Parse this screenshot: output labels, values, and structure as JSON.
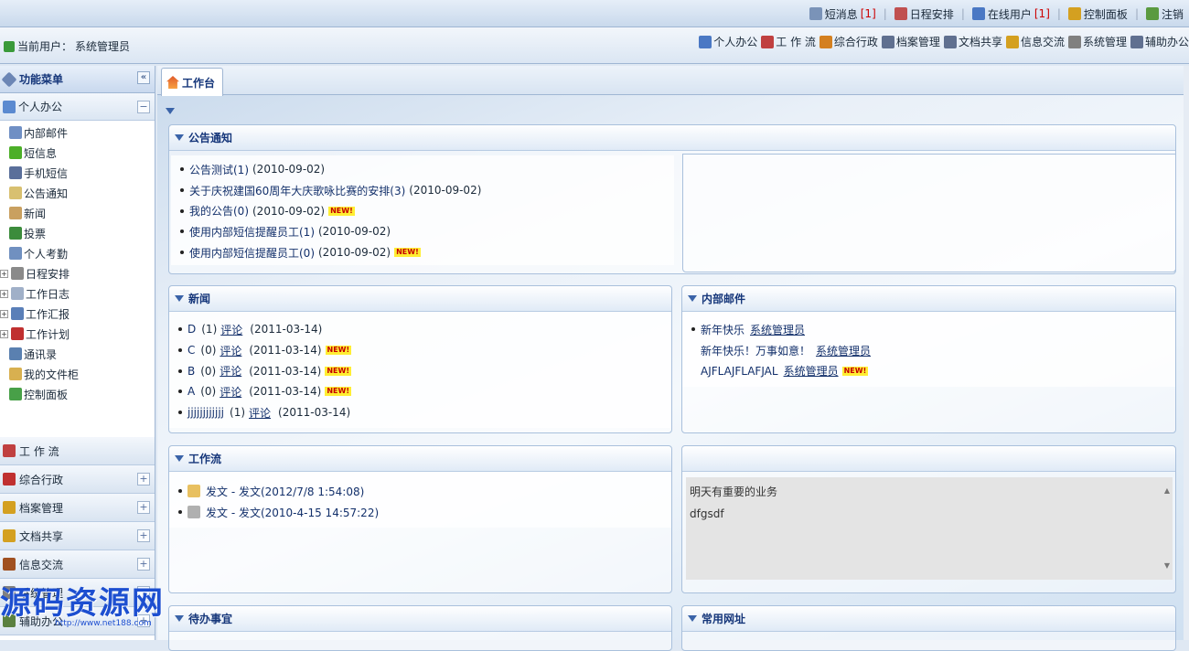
{
  "topbar": {
    "links": [
      {
        "label": "短消息",
        "count": "[1]",
        "icon": "envelope-icon",
        "color": "#7a93b8"
      },
      {
        "label": "日程安排",
        "count": "",
        "icon": "calendar-icon",
        "color": "#c05050"
      },
      {
        "label": "在线用户",
        "count": "[1]",
        "icon": "user-icon",
        "color": "#4a78c4"
      },
      {
        "label": "控制面板",
        "count": "",
        "icon": "key-icon",
        "color": "#d4a020"
      },
      {
        "label": "注销",
        "count": "",
        "icon": "logout-icon",
        "color": "#5a9a40"
      }
    ]
  },
  "userbar": {
    "current_user_label": "当前用户：",
    "current_user": "系统管理员",
    "modules": [
      {
        "label": "个人办公",
        "icon": "personal-office-icon",
        "color": "#4a78c4"
      },
      {
        "label": "工 作 流",
        "icon": "workflow-icon",
        "color": "#c04040"
      },
      {
        "label": "综合行政",
        "icon": "admin-icon",
        "color": "#d48020"
      },
      {
        "label": "档案管理",
        "icon": "archive-icon",
        "color": "#607090"
      },
      {
        "label": "文档共享",
        "icon": "document-share-icon",
        "color": "#607090"
      },
      {
        "label": "信息交流",
        "icon": "info-exchange-icon",
        "color": "#d4a020"
      },
      {
        "label": "系统管理",
        "icon": "system-gear-icon",
        "color": "#808080"
      },
      {
        "label": "辅助办公",
        "icon": "assist-office-icon",
        "color": "#607090"
      }
    ]
  },
  "sidebar": {
    "title": "功能菜单",
    "collapse_glyph": "«",
    "group_open": {
      "label": "个人办公",
      "toggle": "−"
    },
    "tree": [
      {
        "label": "内部邮件",
        "icon": "mail-icon",
        "color": "#6f8fc4",
        "expand": ""
      },
      {
        "label": "短信息",
        "icon": "speech-bubble-icon",
        "color": "#4caf28",
        "expand": ""
      },
      {
        "label": "手机短信",
        "icon": "mobile-phone-icon",
        "color": "#5a6f9a",
        "expand": ""
      },
      {
        "label": "公告通知",
        "icon": "bell-icon",
        "color": "#d8c070",
        "expand": ""
      },
      {
        "label": "新闻",
        "icon": "news-icon",
        "color": "#c9a060",
        "expand": ""
      },
      {
        "label": "投票",
        "icon": "vote-icon",
        "color": "#3c8c3c",
        "expand": ""
      },
      {
        "label": "个人考勤",
        "icon": "attendance-icon",
        "color": "#7090c0",
        "expand": ""
      },
      {
        "label": "日程安排",
        "icon": "calendar-icon",
        "color": "#8a8a8a",
        "expand": "+"
      },
      {
        "label": "工作日志",
        "icon": "log-icon",
        "color": "#a0b0c8",
        "expand": "+"
      },
      {
        "label": "工作汇报",
        "icon": "report-icon",
        "color": "#5a7fb8",
        "expand": "+"
      },
      {
        "label": "工作计划",
        "icon": "plan-icon",
        "color": "#c03030",
        "expand": "+"
      },
      {
        "label": "通讯录",
        "icon": "address-book-icon",
        "color": "#5a80b0",
        "expand": ""
      },
      {
        "label": "我的文件柜",
        "icon": "file-cabinet-icon",
        "color": "#d8b050",
        "expand": ""
      },
      {
        "label": "控制面板",
        "icon": "control-panel-icon",
        "color": "#48a048",
        "expand": ""
      }
    ],
    "groups": [
      {
        "label": "工 作 流",
        "icon": "workflow-icon",
        "color": "#c04040",
        "toggle": ""
      },
      {
        "label": "综合行政",
        "icon": "admin-icon",
        "color": "#c03030",
        "toggle": "+"
      },
      {
        "label": "档案管理",
        "icon": "archive-icon",
        "color": "#d4a020",
        "toggle": "+"
      },
      {
        "label": "文档共享",
        "icon": "document-share-icon",
        "color": "#d4a020",
        "toggle": "+"
      },
      {
        "label": "信息交流",
        "icon": "info-exchange-icon",
        "color": "#a05020",
        "toggle": "+"
      },
      {
        "label": "系统管理",
        "icon": "system-gear-icon",
        "color": "#808080",
        "toggle": "+"
      },
      {
        "label": "辅助办公",
        "icon": "assist-office-icon",
        "color": "#5a8040",
        "toggle": "+"
      }
    ]
  },
  "main": {
    "tab": {
      "label": "工作台",
      "icon": "home-icon"
    },
    "announcements": {
      "title": "公告通知",
      "items": [
        {
          "text": "公告测试(1)",
          "date": "(2010-09-02)",
          "new": false
        },
        {
          "text": "关于庆祝建国60周年大庆歌咏比赛的安排(3)",
          "date": "(2010-09-02)",
          "new": false
        },
        {
          "text": "我的公告(0)",
          "date": "(2010-09-02)",
          "new": true
        },
        {
          "text": "使用内部短信提醒员工(1)",
          "date": "(2010-09-02)",
          "new": false
        },
        {
          "text": "使用内部短信提醒员工(0)",
          "date": "(2010-09-02)",
          "new": true
        }
      ]
    },
    "news": {
      "title": "新闻",
      "items": [
        {
          "title": "D",
          "count": "(1)",
          "comment": "评论",
          "date": "(2011-03-14)",
          "new": false
        },
        {
          "title": "C",
          "count": "(0)",
          "comment": "评论",
          "date": "(2011-03-14)",
          "new": true
        },
        {
          "title": "B",
          "count": "(0)",
          "comment": "评论",
          "date": "(2011-03-14)",
          "new": true
        },
        {
          "title": "A",
          "count": "(0)",
          "comment": "评论",
          "date": "(2011-03-14)",
          "new": true
        },
        {
          "title": "jjjjjjjjjjjj",
          "count": "(1)",
          "comment": "评论",
          "date": "(2011-03-14)",
          "new": false
        }
      ]
    },
    "mail": {
      "title": "内部邮件",
      "items": [
        {
          "subject": "新年快乐",
          "sender": "系统管理员",
          "bullet": true,
          "new": false
        },
        {
          "subject": "新年快乐！万事如意！",
          "sender": "系统管理员",
          "bullet": false,
          "new": false
        },
        {
          "subject": "AJFLAJFLAFJAL",
          "sender": "系统管理员",
          "bullet": false,
          "new": true
        }
      ]
    },
    "workflow": {
      "title": "工作流",
      "items": [
        {
          "text": "发文 - 发文(2012/7/8 1:54:08)",
          "icon": "envelope-open-icon",
          "color": "#e8c060"
        },
        {
          "text": "发文 - 发文(2010-4-15 14:57:22)",
          "icon": "envelope-icon",
          "color": "#b0b0b0"
        }
      ]
    },
    "note": {
      "lines": [
        "明天有重要的业务",
        "dfgsdf"
      ]
    },
    "todo": {
      "title": "待办事宜"
    },
    "links": {
      "title": "常用网址"
    },
    "new_badge": "NEW!"
  },
  "watermark": {
    "title": "源码资源网",
    "url": "http://www.net188.com"
  }
}
